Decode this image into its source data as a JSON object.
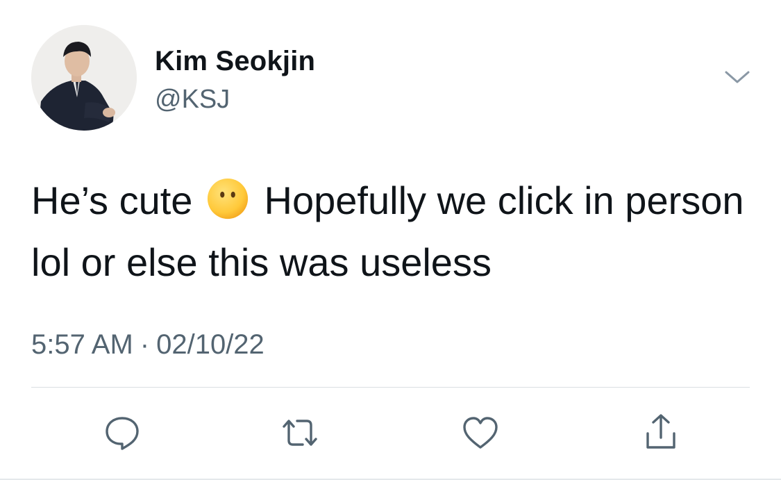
{
  "author": {
    "display_name": "Kim Seokjin",
    "handle": "@KSJ"
  },
  "tweet": {
    "text_part_1": "He’s cute",
    "emoji": "face-without-mouth",
    "text_part_2": "Hopefully we click in person lol or else this was useless",
    "time": "5:57 AM",
    "separator": "·",
    "date": "02/10/22"
  },
  "actions": [
    {
      "name": "reply",
      "icon": "speech-bubble-icon"
    },
    {
      "name": "retweet",
      "icon": "retweet-icon"
    },
    {
      "name": "like",
      "icon": "heart-icon"
    },
    {
      "name": "share",
      "icon": "share-icon"
    }
  ],
  "colors": {
    "text": "#0f1419",
    "secondary": "#536471",
    "divider": "#d9dee2",
    "emoji": "#ffcc3c"
  }
}
